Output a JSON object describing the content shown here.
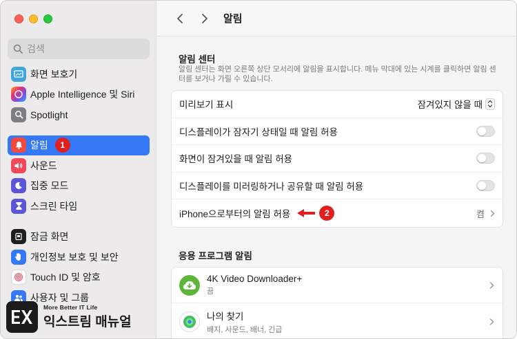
{
  "search": {
    "placeholder": "검색"
  },
  "sidebar": {
    "items": [
      {
        "label": "화면 보호기",
        "icon": "screensaver-icon"
      },
      {
        "label": "Apple Intelligence 및 Siri",
        "icon": "siri-icon"
      },
      {
        "label": "Spotlight",
        "icon": "spotlight-icon"
      },
      {
        "label": "알림",
        "icon": "bell-icon",
        "active": true,
        "badge": "1"
      },
      {
        "label": "사운드",
        "icon": "speaker-icon"
      },
      {
        "label": "집중 모드",
        "icon": "moon-icon"
      },
      {
        "label": "스크린 타임",
        "icon": "hourglass-icon"
      },
      {
        "label": "잠금 화면",
        "icon": "lock-screen-icon"
      },
      {
        "label": "개인정보 보호 및 보안",
        "icon": "hand-icon"
      },
      {
        "label": "Touch ID 및 암호",
        "icon": "fingerprint-icon"
      },
      {
        "label": "사용자 및 그룹",
        "icon": "users-icon"
      }
    ]
  },
  "toolbar": {
    "title": "알림"
  },
  "notification_center": {
    "heading": "알림 센터",
    "description": "알림 센터는 화면 오른쪽 상단 모서리에 알림을 표시합니다. 메뉴 막대에 있는 시계를 클릭하면 알림 센터를 보거나 가릴 수 있습니다.",
    "rows": [
      {
        "label": "미리보기 표시",
        "value": "잠겨있지 않을 때"
      },
      {
        "label": "디스플레이가 잠자기 상태일 때 알림 허용",
        "toggle": false
      },
      {
        "label": "화면이 잠겨있을 때 알림 허용",
        "toggle": false
      },
      {
        "label": "디스플레이를 미러링하거나 공유할 때 알림 허용",
        "toggle": false
      },
      {
        "label": "iPhone으로부터의 알림 허용",
        "value": "켬",
        "badge": "2"
      }
    ]
  },
  "app_notifications": {
    "heading": "응용 프로그램 알림",
    "apps": [
      {
        "name": "4K Video Downloader+",
        "sub": "끔",
        "icon": "4k-downloader-icon"
      },
      {
        "name": "나의 찾기",
        "sub": "배지, 사운드, 배너, 긴급",
        "icon": "find-my-icon"
      }
    ]
  },
  "watermark": {
    "tagline": "More Better IT Life",
    "brand": "익스트림 매뉴얼"
  },
  "colors": {
    "accent": "#3478f6",
    "badge": "#e02020"
  }
}
